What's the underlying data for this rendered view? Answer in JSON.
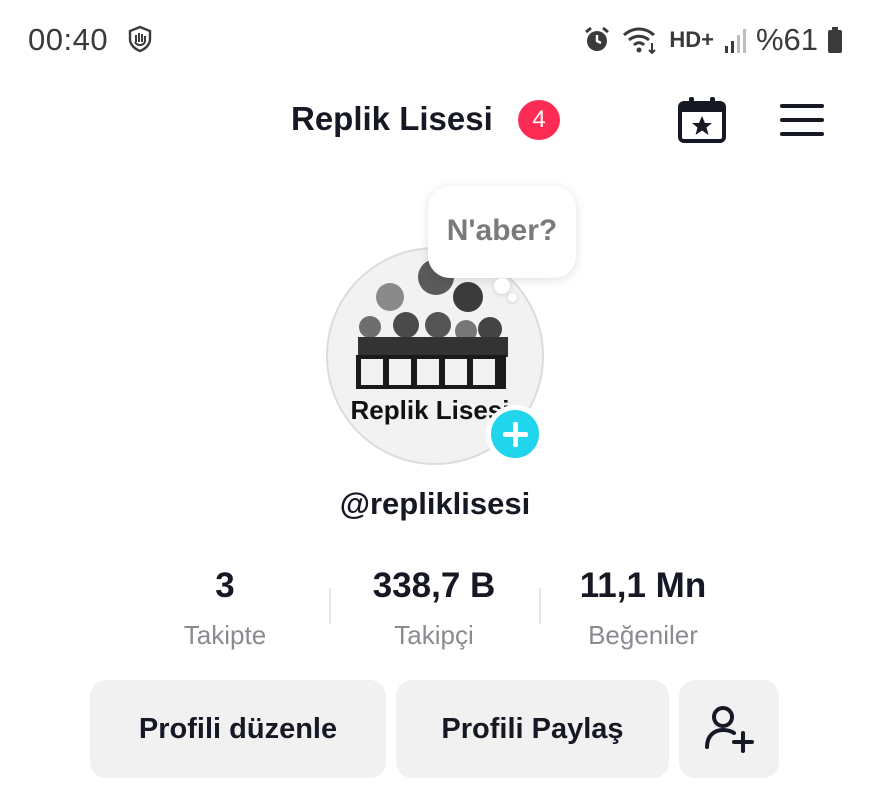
{
  "status_bar": {
    "time": "00:40",
    "hd_label": "HD+",
    "battery": "%61"
  },
  "header": {
    "title": "Replik Lisesi",
    "notification_count": "4"
  },
  "profile": {
    "avatar_text": "Replik Lisesi",
    "bubble_text": "N'aber?",
    "username": "@repliklisesi"
  },
  "stats": [
    {
      "value": "3",
      "label": "Takipte"
    },
    {
      "value": "338,7 B",
      "label": "Takipçi"
    },
    {
      "value": "11,1 Mn",
      "label": "Beğeniler"
    }
  ],
  "actions": {
    "edit_profile": "Profili düzenle",
    "share_profile": "Profili Paylaş"
  },
  "colors": {
    "accent_red": "#fe2c55",
    "accent_cyan": "#20d5ec"
  }
}
